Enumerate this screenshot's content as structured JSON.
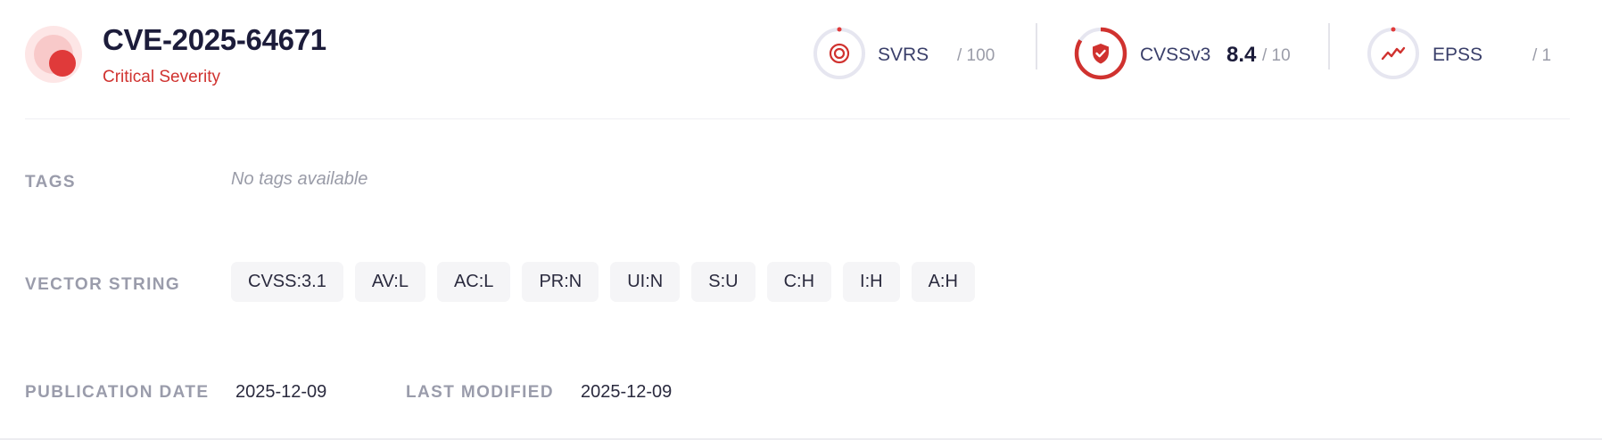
{
  "header": {
    "cve_id": "CVE-2025-64671",
    "severity_label": "Critical Severity"
  },
  "colors": {
    "critical": "#e03a3a",
    "severity_text": "#d0322f",
    "ring_track": "#e6e6f0",
    "label_text": "#3a3f6a"
  },
  "metrics": [
    {
      "label": "SVRS",
      "value": "",
      "max": "/ 100",
      "icon": "target-icon",
      "fill_fraction": 0
    },
    {
      "label": "CVSSv3",
      "value": "8.4",
      "max": "/ 10",
      "icon": "shield-check-icon",
      "fill_fraction": 0.84
    },
    {
      "label": "EPSS",
      "value": "",
      "max": "/ 1",
      "icon": "trend-line-icon",
      "fill_fraction": 0
    }
  ],
  "details": {
    "tags_label": "TAGS",
    "tags_empty": "No tags available",
    "vector_label": "VECTOR STRING",
    "vector": [
      "CVSS:3.1",
      "AV:L",
      "AC:L",
      "PR:N",
      "UI:N",
      "S:U",
      "C:H",
      "I:H",
      "A:H"
    ],
    "publication_label": "PUBLICATION DATE",
    "publication_date": "2025-12-09",
    "modified_label": "LAST MODIFIED",
    "modified_date": "2025-12-09"
  }
}
